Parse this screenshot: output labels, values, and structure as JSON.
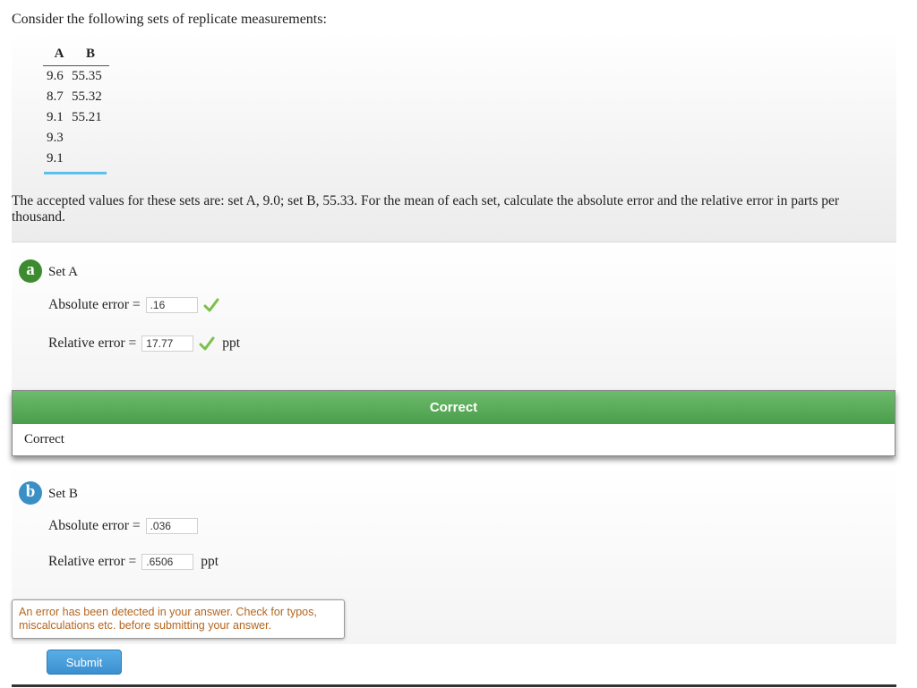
{
  "question": {
    "intro": "Consider the following sets of replicate measurements:",
    "table": {
      "headers": [
        "A",
        "B"
      ],
      "rows": [
        [
          "9.6",
          "55.35"
        ],
        [
          "8.7",
          "55.32"
        ],
        [
          "9.1",
          "55.21"
        ],
        [
          "9.3",
          ""
        ],
        [
          "9.1",
          ""
        ]
      ]
    },
    "prompt": "The accepted values for these sets are: set A, 9.0; set B, 55.33. For the mean of each set, calculate the absolute error and the relative error in parts per thousand."
  },
  "part_a": {
    "badge": "a",
    "title": "Set A",
    "absolute_label": "Absolute error =",
    "absolute_value": ".16",
    "relative_label": "Relative error =",
    "relative_value": "17.77",
    "unit": "ppt",
    "feedback_header": "Correct",
    "feedback_body": "Correct"
  },
  "part_b": {
    "badge": "b",
    "title": "Set B",
    "absolute_label": "Absolute error =",
    "absolute_value": ".036",
    "relative_label": "Relative error =",
    "relative_value": ".6506",
    "unit": "ppt",
    "error_message": "An error has been detected in your answer. Check for typos, miscalculations etc. before submitting your answer.",
    "submit_label": "Submit"
  },
  "colors": {
    "correct_green": "#4a9d4a",
    "badge_a": "#3d8b2f",
    "badge_b": "#3a8fc4",
    "check_green": "#7cbf4a",
    "error_text": "#b5651d",
    "accent_blue": "#5bc0eb"
  },
  "icons": {
    "check": "check-icon"
  }
}
